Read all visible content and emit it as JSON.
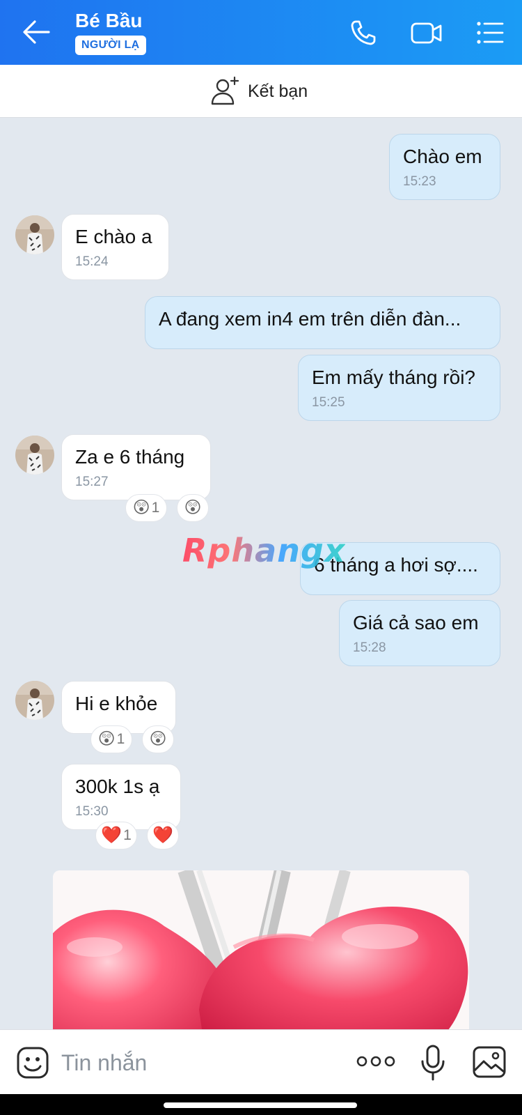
{
  "header": {
    "title": "Bé Bầu",
    "badge": "NGƯỜI LẠ"
  },
  "add_friend": {
    "label": "Kết bạn"
  },
  "messages": [
    {
      "dir": "out",
      "text": "Chào em",
      "time": "15:23"
    },
    {
      "dir": "in",
      "text": "E chào a",
      "time": "15:24"
    },
    {
      "dir": "out",
      "text": "A đang xem in4 em trên diễn đàn...",
      "time": ""
    },
    {
      "dir": "out",
      "text": "Em mấy tháng rồi?",
      "time": "15:25"
    },
    {
      "dir": "in",
      "text": "Za e 6 tháng",
      "time": "15:27",
      "reaction": {
        "emoji": "😲",
        "count": "1"
      }
    },
    {
      "dir": "out",
      "text": "6 tháng a hơi sợ....",
      "time": ""
    },
    {
      "dir": "out",
      "text": "Giá cả sao em",
      "time": "15:28"
    },
    {
      "dir": "in",
      "text": "Hi e khỏe",
      "time": "",
      "reaction": {
        "emoji": "😲",
        "count": "1"
      }
    },
    {
      "dir": "in",
      "text": "300k 1s ạ",
      "time": "15:30",
      "reaction": {
        "emoji": "❤️",
        "count": "1"
      }
    }
  ],
  "watermark": "Rphangx",
  "composer": {
    "placeholder": "Tin nhắn"
  },
  "icons": {
    "back": "arrow-left-icon",
    "call": "phone-icon",
    "video": "video-camera-icon",
    "menu": "list-menu-icon",
    "add_friend": "add-user-icon",
    "sticker": "emoji-icon",
    "more": "more-icon",
    "mic": "microphone-icon",
    "image": "image-icon"
  },
  "colors": {
    "header_start": "#1f73f0",
    "header_end": "#1b9cf5",
    "bubble_out": "#d7ecfb",
    "bubble_in": "#ffffff",
    "chat_bg": "#e2e8ef"
  }
}
